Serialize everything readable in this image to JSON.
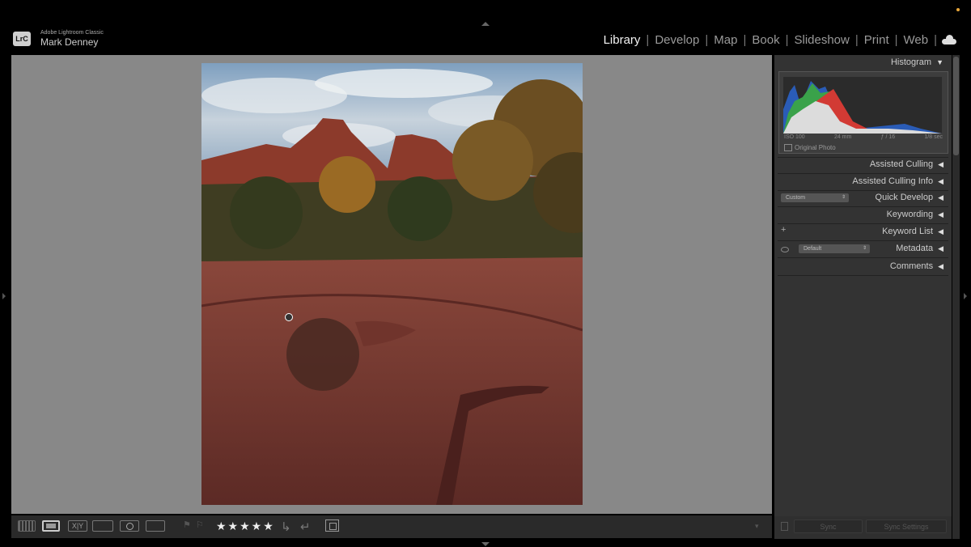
{
  "app": {
    "product": "Adobe Lightroom Classic",
    "user": "Mark Denney",
    "logo_text": "LrC"
  },
  "modules": [
    {
      "label": "Library",
      "active": true
    },
    {
      "label": "Develop",
      "active": false
    },
    {
      "label": "Map",
      "active": false
    },
    {
      "label": "Book",
      "active": false
    },
    {
      "label": "Slideshow",
      "active": false
    },
    {
      "label": "Print",
      "active": false
    },
    {
      "label": "Web",
      "active": false
    }
  ],
  "module_separator": "|",
  "toolbar": {
    "compare_label": "X|Y",
    "stars": "★★★★★",
    "rotate_left": "↳",
    "rotate_right": "↵",
    "flag_pick": "⚑",
    "flag_reject": "⚐",
    "dropdown": "▾"
  },
  "panel": {
    "histogram": {
      "title": "Histogram",
      "iso": "ISO 100",
      "focal": "24 mm",
      "aperture": "ƒ / 16",
      "shutter": "1/8 sec",
      "original_photo": "Original Photo"
    },
    "sections": {
      "assisted_culling": "Assisted Culling",
      "assisted_culling_info": "Assisted Culling Info",
      "quick_develop": "Quick Develop",
      "quick_develop_preset": "Custom",
      "keywording": "Keywording",
      "keyword_list": "Keyword List",
      "metadata": "Metadata",
      "metadata_preset": "Default",
      "comments": "Comments"
    },
    "arrows": {
      "expanded": "▼",
      "collapsed": "◀"
    },
    "footer": {
      "sync": "Sync",
      "sync_settings": "Sync Settings"
    }
  },
  "colors": {
    "background": "#888888",
    "panel": "#333333",
    "accent": "#e8a73a"
  }
}
